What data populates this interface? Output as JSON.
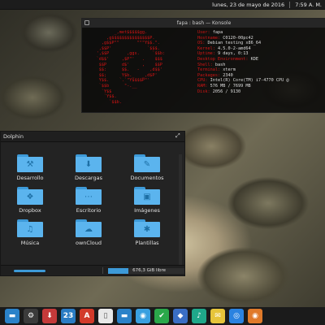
{
  "panel": {
    "date": "lunes, 23 de mayo de 2016",
    "time": "7:59 A. M."
  },
  "konsole": {
    "title": "fapa : bash — Konsole",
    "ascii_lines": [
      "            _,met$$$$$gg.",
      "         ,g$$$$$$$$$$$$$$$P.",
      "       ,g$$P\"\"       \"\"\"Y$$.\".",
      "      ,$$P'              `$$$.",
      "     ',$$P       ,ggs.     `$$b:",
      "     `d$$'     ,$P\"'   .    $$$",
      "      $$P      d$'     ,    $$P",
      "      $$:      $$.   -    ,d$$'",
      "      $$;      Y$b._   _,d$P'",
      "      Y$$.    `.`\"Y$$$$P\"'",
      "      `$$b      \"-.__",
      "       `Y$$",
      "        `Y$$.",
      "          `$$b."
    ],
    "info": [
      {
        "k": "User:",
        "v": "fapa"
      },
      {
        "k": "Hostname:",
        "v": "C0120-00pc42"
      },
      {
        "k": "OS:",
        "v": "Debian testing x86_64"
      },
      {
        "k": "Kernel:",
        "v": "4.5.0-2-amd64"
      },
      {
        "k": "Uptime:",
        "v": "9 days, 0:13"
      },
      {
        "k": "Desktop Environment:",
        "v": "KDE"
      },
      {
        "k": "Shell:",
        "v": "bash"
      },
      {
        "k": "Terminal:",
        "v": "xterm"
      },
      {
        "k": "Packages:",
        "v": "2340"
      },
      {
        "k": "CPU:",
        "v": "Intel(R) Core(TM) i7-4770 CPU @"
      },
      {
        "k": "RAM:",
        "v": "576 MB / 7699 MB"
      },
      {
        "k": "Disk:",
        "v": "2056 / 9130"
      }
    ]
  },
  "dolphin": {
    "title": "Dolphin",
    "folders": [
      {
        "label": "Desarrollo",
        "glyph": "⚒"
      },
      {
        "label": "Descargas",
        "glyph": "⬇"
      },
      {
        "label": "Documentos",
        "glyph": "✎"
      },
      {
        "label": "Dropbox",
        "glyph": "❖"
      },
      {
        "label": "Escritorio",
        "glyph": "⋯"
      },
      {
        "label": "Imágenes",
        "glyph": "▣"
      },
      {
        "label": "Música",
        "glyph": "♫"
      },
      {
        "label": "ownCloud",
        "glyph": "☁"
      },
      {
        "label": "Plantillas",
        "glyph": "✱"
      }
    ],
    "status": {
      "zoom_label": "",
      "free_space": "676,3 GiB libre",
      "used_fraction": 0.26
    }
  },
  "taskbar": [
    {
      "name": "folder",
      "glyph": "▬",
      "color": "#2a82c9"
    },
    {
      "name": "settings",
      "glyph": "⚙",
      "color": "#3b3b3b"
    },
    {
      "name": "download",
      "glyph": "⬇",
      "color": "#c43a3a"
    },
    {
      "name": "calendar",
      "glyph": "23",
      "color": "#2a7cc4"
    },
    {
      "name": "pdf",
      "glyph": "A",
      "color": "#d23a2a"
    },
    {
      "name": "document",
      "glyph": "▯",
      "color": "#e8e8e8"
    },
    {
      "name": "files",
      "glyph": "▬",
      "color": "#2a82c9"
    },
    {
      "name": "monitor",
      "glyph": "◉",
      "color": "#3aa0e0"
    },
    {
      "name": "shield",
      "glyph": "✔",
      "color": "#2aa84a"
    },
    {
      "name": "network",
      "glyph": "◆",
      "color": "#3a6ec4"
    },
    {
      "name": "music",
      "glyph": "♪",
      "color": "#1fa88a"
    },
    {
      "name": "notes",
      "glyph": "✉",
      "color": "#e6c43a"
    },
    {
      "name": "browser",
      "glyph": "◎",
      "color": "#2a82e0"
    },
    {
      "name": "firefox",
      "glyph": "◉",
      "color": "#e07a2a"
    }
  ]
}
